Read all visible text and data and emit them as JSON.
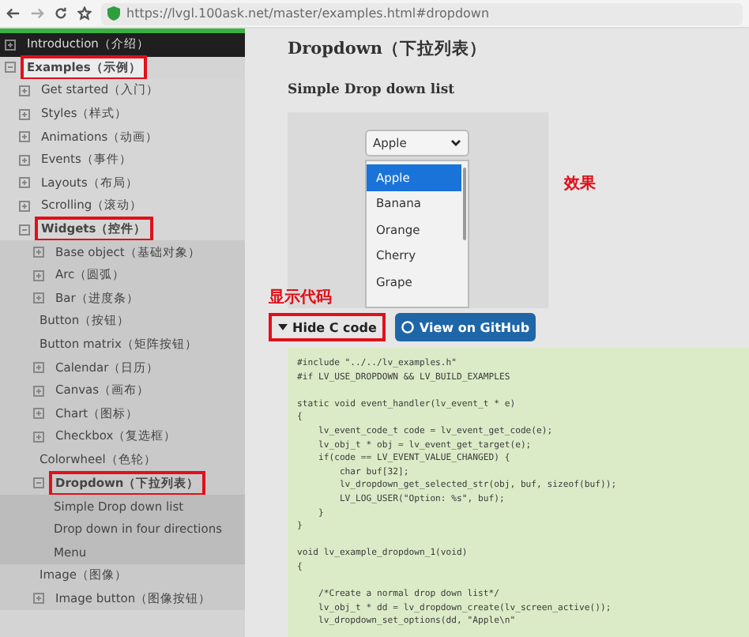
{
  "browser": {
    "url": "https://lvgl.100ask.net/master/examples.html#dropdown"
  },
  "sidebar": {
    "items": [
      {
        "label": "Introduction（介绍）",
        "kind": "group",
        "expanded": false,
        "annotated": false
      },
      {
        "label": "Examples（示例）",
        "kind": "group",
        "expanded": true,
        "annotated": true,
        "children": [
          {
            "label": "Get started（入门）",
            "kind": "group",
            "expanded": false,
            "annotated": false
          },
          {
            "label": "Styles（样式）",
            "kind": "group",
            "expanded": false,
            "annotated": false
          },
          {
            "label": "Animations（动画）",
            "kind": "group",
            "expanded": false,
            "annotated": false
          },
          {
            "label": "Events（事件）",
            "kind": "group",
            "expanded": false,
            "annotated": false
          },
          {
            "label": "Layouts（布局）",
            "kind": "group",
            "expanded": false,
            "annotated": false
          },
          {
            "label": "Scrolling（滚动）",
            "kind": "group",
            "expanded": false,
            "annotated": false
          },
          {
            "label": "Widgets（控件）",
            "kind": "group",
            "expanded": true,
            "annotated": true,
            "children": [
              {
                "label": "Base object（基础对象）",
                "kind": "group",
                "expanded": false,
                "annotated": false
              },
              {
                "label": "Arc（圆弧）",
                "kind": "group",
                "expanded": false,
                "annotated": false
              },
              {
                "label": "Bar（进度条）",
                "kind": "group",
                "expanded": false,
                "annotated": false
              },
              {
                "label": "Button（按钮）",
                "kind": "leaf",
                "annotated": false
              },
              {
                "label": "Button matrix（矩阵按钮）",
                "kind": "leaf",
                "annotated": false
              },
              {
                "label": "Calendar（日历）",
                "kind": "group",
                "expanded": false,
                "annotated": false
              },
              {
                "label": "Canvas（画布）",
                "kind": "group",
                "expanded": false,
                "annotated": false
              },
              {
                "label": "Chart（图标）",
                "kind": "group",
                "expanded": false,
                "annotated": false
              },
              {
                "label": "Checkbox（复选框）",
                "kind": "group",
                "expanded": false,
                "annotated": false
              },
              {
                "label": "Colorwheel（色轮）",
                "kind": "leaf",
                "annotated": false
              },
              {
                "label": "Dropdown（下拉列表）",
                "kind": "group",
                "expanded": true,
                "annotated": true,
                "children": [
                  {
                    "label": "Simple Drop down list",
                    "kind": "leaf",
                    "annotated": false
                  },
                  {
                    "label": "Drop down in four directions",
                    "kind": "leaf",
                    "annotated": false
                  },
                  {
                    "label": "Menu",
                    "kind": "leaf",
                    "annotated": false
                  }
                ]
              },
              {
                "label": "Image（图像）",
                "kind": "leaf",
                "annotated": false
              },
              {
                "label": "Image button（图像按钮）",
                "kind": "group",
                "expanded": false,
                "annotated": false
              }
            ]
          }
        ]
      }
    ]
  },
  "content": {
    "title": "Dropdown（下拉列表）",
    "subtitle": "Simple Drop down list",
    "demo": {
      "dropdown": {
        "value": "Apple",
        "options": [
          {
            "label": "Apple",
            "selected": true
          },
          {
            "label": "Banana",
            "selected": false
          },
          {
            "label": "Orange",
            "selected": false
          },
          {
            "label": "Cherry",
            "selected": false
          },
          {
            "label": "Grape",
            "selected": false
          }
        ]
      },
      "effect_note": "效果"
    },
    "code_note": "显示代码",
    "buttons": [
      {
        "label": "Hide C code",
        "kind": "toggle",
        "annotated": true
      },
      {
        "label": "View on GitHub",
        "kind": "github",
        "annotated": false
      }
    ],
    "code_blocks": [
      [
        "#include \"../../lv_examples.h\"",
        "#if LV_USE_DROPDOWN && LV_BUILD_EXAMPLES"
      ],
      [
        "static void event_handler(lv_event_t * e)",
        "{",
        "    lv_event_code_t code = lv_event_get_code(e);",
        "    lv_obj_t * obj = lv_event_get_target(e);",
        "    if(code == LV_EVENT_VALUE_CHANGED) {",
        "        char buf[32];",
        "        lv_dropdown_get_selected_str(obj, buf, sizeof(buf));",
        "        LV_LOG_USER(\"Option: %s\", buf);",
        "    }",
        "}"
      ],
      [
        "void lv_example_dropdown_1(void)",
        "{"
      ],
      [
        "    /*Create a normal drop down list*/",
        "    lv_obj_t * dd = lv_dropdown_create(lv_screen_active());",
        "    lv_dropdown_set_options(dd, \"Apple\\n\""
      ]
    ]
  }
}
